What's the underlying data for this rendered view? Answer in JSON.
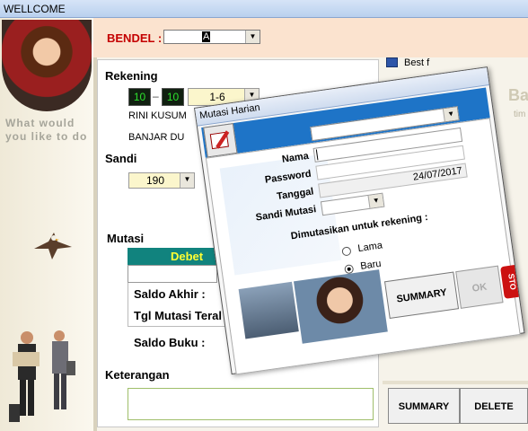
{
  "window": {
    "title": "WELLCOME"
  },
  "sidebar": {
    "slogan": "What would you like to do"
  },
  "bendel": {
    "label": "BENDEL :",
    "value": "A"
  },
  "rekening": {
    "label": "Rekening",
    "code1": "10",
    "dash": "–",
    "code2": "10",
    "type": "1-6",
    "name": "RINI KUSUM",
    "address": "BANJAR DU"
  },
  "sandi": {
    "label": "Sandi",
    "value": "190"
  },
  "mutasi": {
    "label": "Mutasi",
    "debet": "Debet",
    "saldo_akhir": "Saldo Akhir :",
    "tgl_mutasi": "Tgl Mutasi Teral",
    "saldo_buku": "Saldo Buku :"
  },
  "keterangan": {
    "label": "Keterangan"
  },
  "right": {
    "best": "Best f",
    "banner": "Ba",
    "banner_sub": "tim"
  },
  "buttons": {
    "summary": "SUMMARY",
    "delete": "DELETE"
  },
  "dialog": {
    "title": "Mutasi Harian",
    "nama_label": "Nama",
    "password_label": "Password",
    "tanggal_label": "Tanggal",
    "sandi_label": "Sandi Mutasi",
    "tanggal_value": "24/07/2017",
    "dimutasikan": "Dimutasikan untuk rekening :",
    "radio_lama": "Lama",
    "radio_baru": "Baru",
    "summary_btn": "SUMMARY",
    "ok_btn": "OK",
    "stop_text": "STO"
  }
}
